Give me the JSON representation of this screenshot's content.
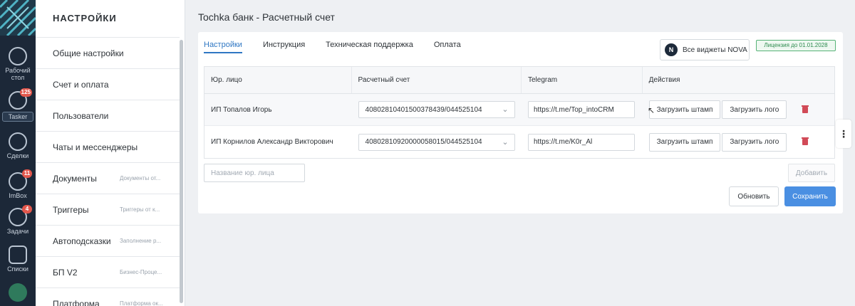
{
  "rail": {
    "items": [
      {
        "label": "Рабочий стол",
        "icon": "gauge-icon"
      },
      {
        "label": "Tasker",
        "icon": "grid-icon",
        "badge": "125"
      },
      {
        "label": "Сделки",
        "icon": "dollar-icon"
      },
      {
        "label": "ImBox",
        "icon": "chat-icon",
        "badge": "11"
      },
      {
        "label": "Задачи",
        "icon": "check-icon",
        "badge": "4"
      },
      {
        "label": "Списки",
        "icon": "list-icon"
      }
    ]
  },
  "sidebar": {
    "title": "НАСТРОЙКИ",
    "items": [
      {
        "label": "Общие настройки",
        "hint": ""
      },
      {
        "label": "Счет и оплата",
        "hint": ""
      },
      {
        "label": "Пользователи",
        "hint": ""
      },
      {
        "label": "Чаты и мессенджеры",
        "hint": ""
      },
      {
        "label": "Документы",
        "hint": "Документы от..."
      },
      {
        "label": "Триггеры",
        "hint": "Триггеры от к..."
      },
      {
        "label": "Автоподсказки",
        "hint": "Заполнение р..."
      },
      {
        "label": "БП V2",
        "hint": "Бизнес-Проце..."
      },
      {
        "label": "Платформа",
        "hint": "Платформа ок..."
      }
    ]
  },
  "page": {
    "title": "Tochka банк - Расчетный счет"
  },
  "tabs": [
    {
      "label": "Настройки",
      "active": true
    },
    {
      "label": "Инструкция",
      "active": false
    },
    {
      "label": "Техническая поддержка",
      "active": false
    },
    {
      "label": "Оплата",
      "active": false
    }
  ],
  "widgets_button": {
    "label": "Все виджеты NOVA",
    "logo_text": "N"
  },
  "license": {
    "label": "Лицензия до 01.01.2028"
  },
  "table": {
    "headers": [
      "Юр. лицо",
      "Расчетный счет",
      "Telegram",
      "Действия"
    ],
    "rows": [
      {
        "entity": "ИП Топалов Игорь",
        "account": "40802810401500378439/044525104",
        "telegram": "https://t.me/Top_intoCRM",
        "stamp": "Загрузить штамп",
        "logo": "Загрузить лого"
      },
      {
        "entity": "ИП Корнилов Александр Викторович",
        "account": "40802810920000058015/044525104",
        "telegram": "https://t.me/K0r_Al",
        "stamp": "Загрузить штамп",
        "logo": "Загрузить лого"
      }
    ]
  },
  "form": {
    "name_placeholder": "Название юр. лица",
    "add_label": "Добавить",
    "refresh_label": "Обновить",
    "save_label": "Сохранить"
  },
  "colors": {
    "accent": "#4a8fe2",
    "rail": "#1c2838",
    "license": "#2d8a4e",
    "delete": "#d14a57"
  }
}
